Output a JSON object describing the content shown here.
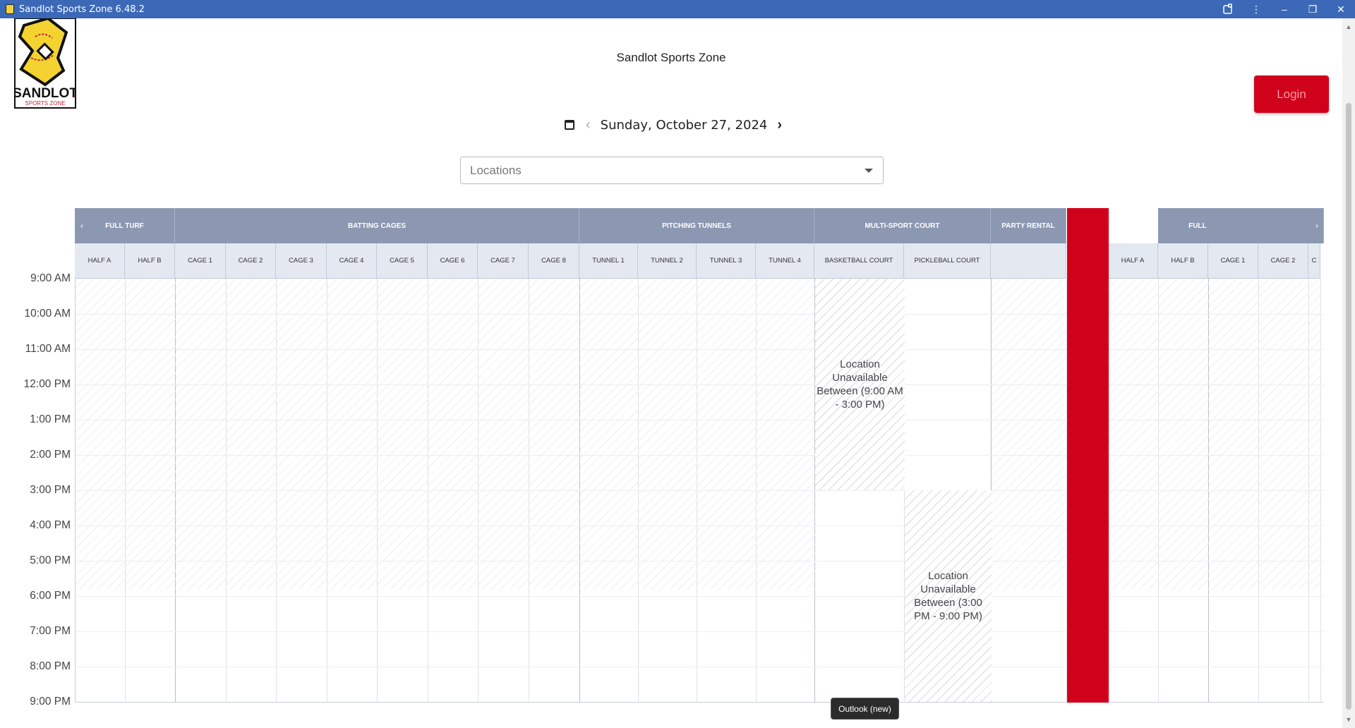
{
  "window": {
    "title": "Sandlot Sports Zone 6.48.2",
    "controls": [
      "extensions-icon",
      "more-icon",
      "minimize-icon",
      "restore-icon",
      "close-icon"
    ]
  },
  "header": {
    "site_title": "Sandlot Sports Zone",
    "login_label": "Login",
    "logo_text": "SANDLOT SPORTS ZONE"
  },
  "datebar": {
    "date": "Sunday, October 27, 2024"
  },
  "filter": {
    "placeholder": "Locations"
  },
  "schedule": {
    "groups": [
      "FULL TURF",
      "BATTING CAGES",
      "PITCHING TUNNELS",
      "MULTI-SPORT COURT",
      "PARTY RENTAL",
      "FULL TURF"
    ],
    "sub_columns": [
      "HALF A",
      "HALF B",
      "CAGE 1",
      "CAGE 2",
      "CAGE 3",
      "CAGE 4",
      "CAGE 5",
      "CAGE 6",
      "CAGE 7",
      "CAGE 8",
      "TUNNEL 1",
      "TUNNEL 2",
      "TUNNEL 3",
      "TUNNEL 4",
      "BASKETBALL COURT",
      "PICKLEBALL COURT",
      "",
      "HALF A",
      "HALF B",
      "CAGE 1",
      "CAGE 2",
      "C"
    ],
    "times": [
      "9:00 AM",
      "10:00 AM",
      "11:00 AM",
      "12:00 PM",
      "1:00 PM",
      "2:00 PM",
      "3:00 PM",
      "4:00 PM",
      "5:00 PM",
      "6:00 PM",
      "7:00 PM",
      "8:00 PM",
      "9:00 PM"
    ],
    "unavailable": [
      {
        "column": "BASKETBALL COURT",
        "text": "Location Unavailable Between (9:00 AM - 3:00 PM)"
      },
      {
        "column": "PICKLEBALL COURT",
        "text": "Location Unavailable Between (3:00 PM - 9:00 PM)"
      }
    ],
    "accent_color": "#d0021b",
    "header_color": "#8c98b1"
  },
  "taskbar_tooltip": "Outlook (new)"
}
